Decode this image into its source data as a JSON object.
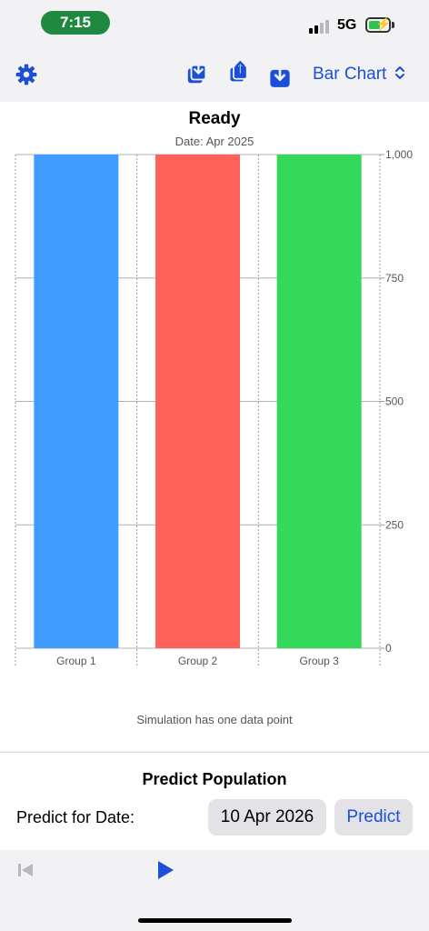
{
  "status_bar": {
    "time": "7:15",
    "network": "5G",
    "signal_bars_active": 2,
    "signal_bars_total": 4,
    "battery_level": 0.5,
    "charging": true
  },
  "toolbar": {
    "chart_type_label": "Bar Chart",
    "accent_color": "#1b4fd6",
    "icons": [
      "gear-icon",
      "import-icon",
      "share-icon",
      "download-icon",
      "chevron-updown-icon"
    ]
  },
  "chart": {
    "title": "Ready",
    "subtitle": "Date: Apr 2025",
    "note": "Simulation has one data point"
  },
  "chart_data": {
    "type": "bar",
    "categories": [
      "Group 1",
      "Group 2",
      "Group 3"
    ],
    "values": [
      1000,
      1000,
      1000
    ],
    "colors": [
      "#409cff",
      "#ff6259",
      "#34d95b"
    ],
    "ylim": [
      0,
      1000
    ],
    "yticks": [
      0,
      250,
      500,
      750,
      1000
    ],
    "ytick_labels": [
      "0",
      "250",
      "500",
      "750",
      "1,000"
    ],
    "y_axis_side": "right",
    "grid": true,
    "xlabel": "",
    "ylabel": ""
  },
  "predict": {
    "title": "Predict Population",
    "label": "Predict for Date:",
    "date_value": "10 Apr 2026",
    "button_label": "Predict"
  },
  "playback": {
    "icons": [
      "skip-back-icon",
      "play-icon"
    ]
  }
}
